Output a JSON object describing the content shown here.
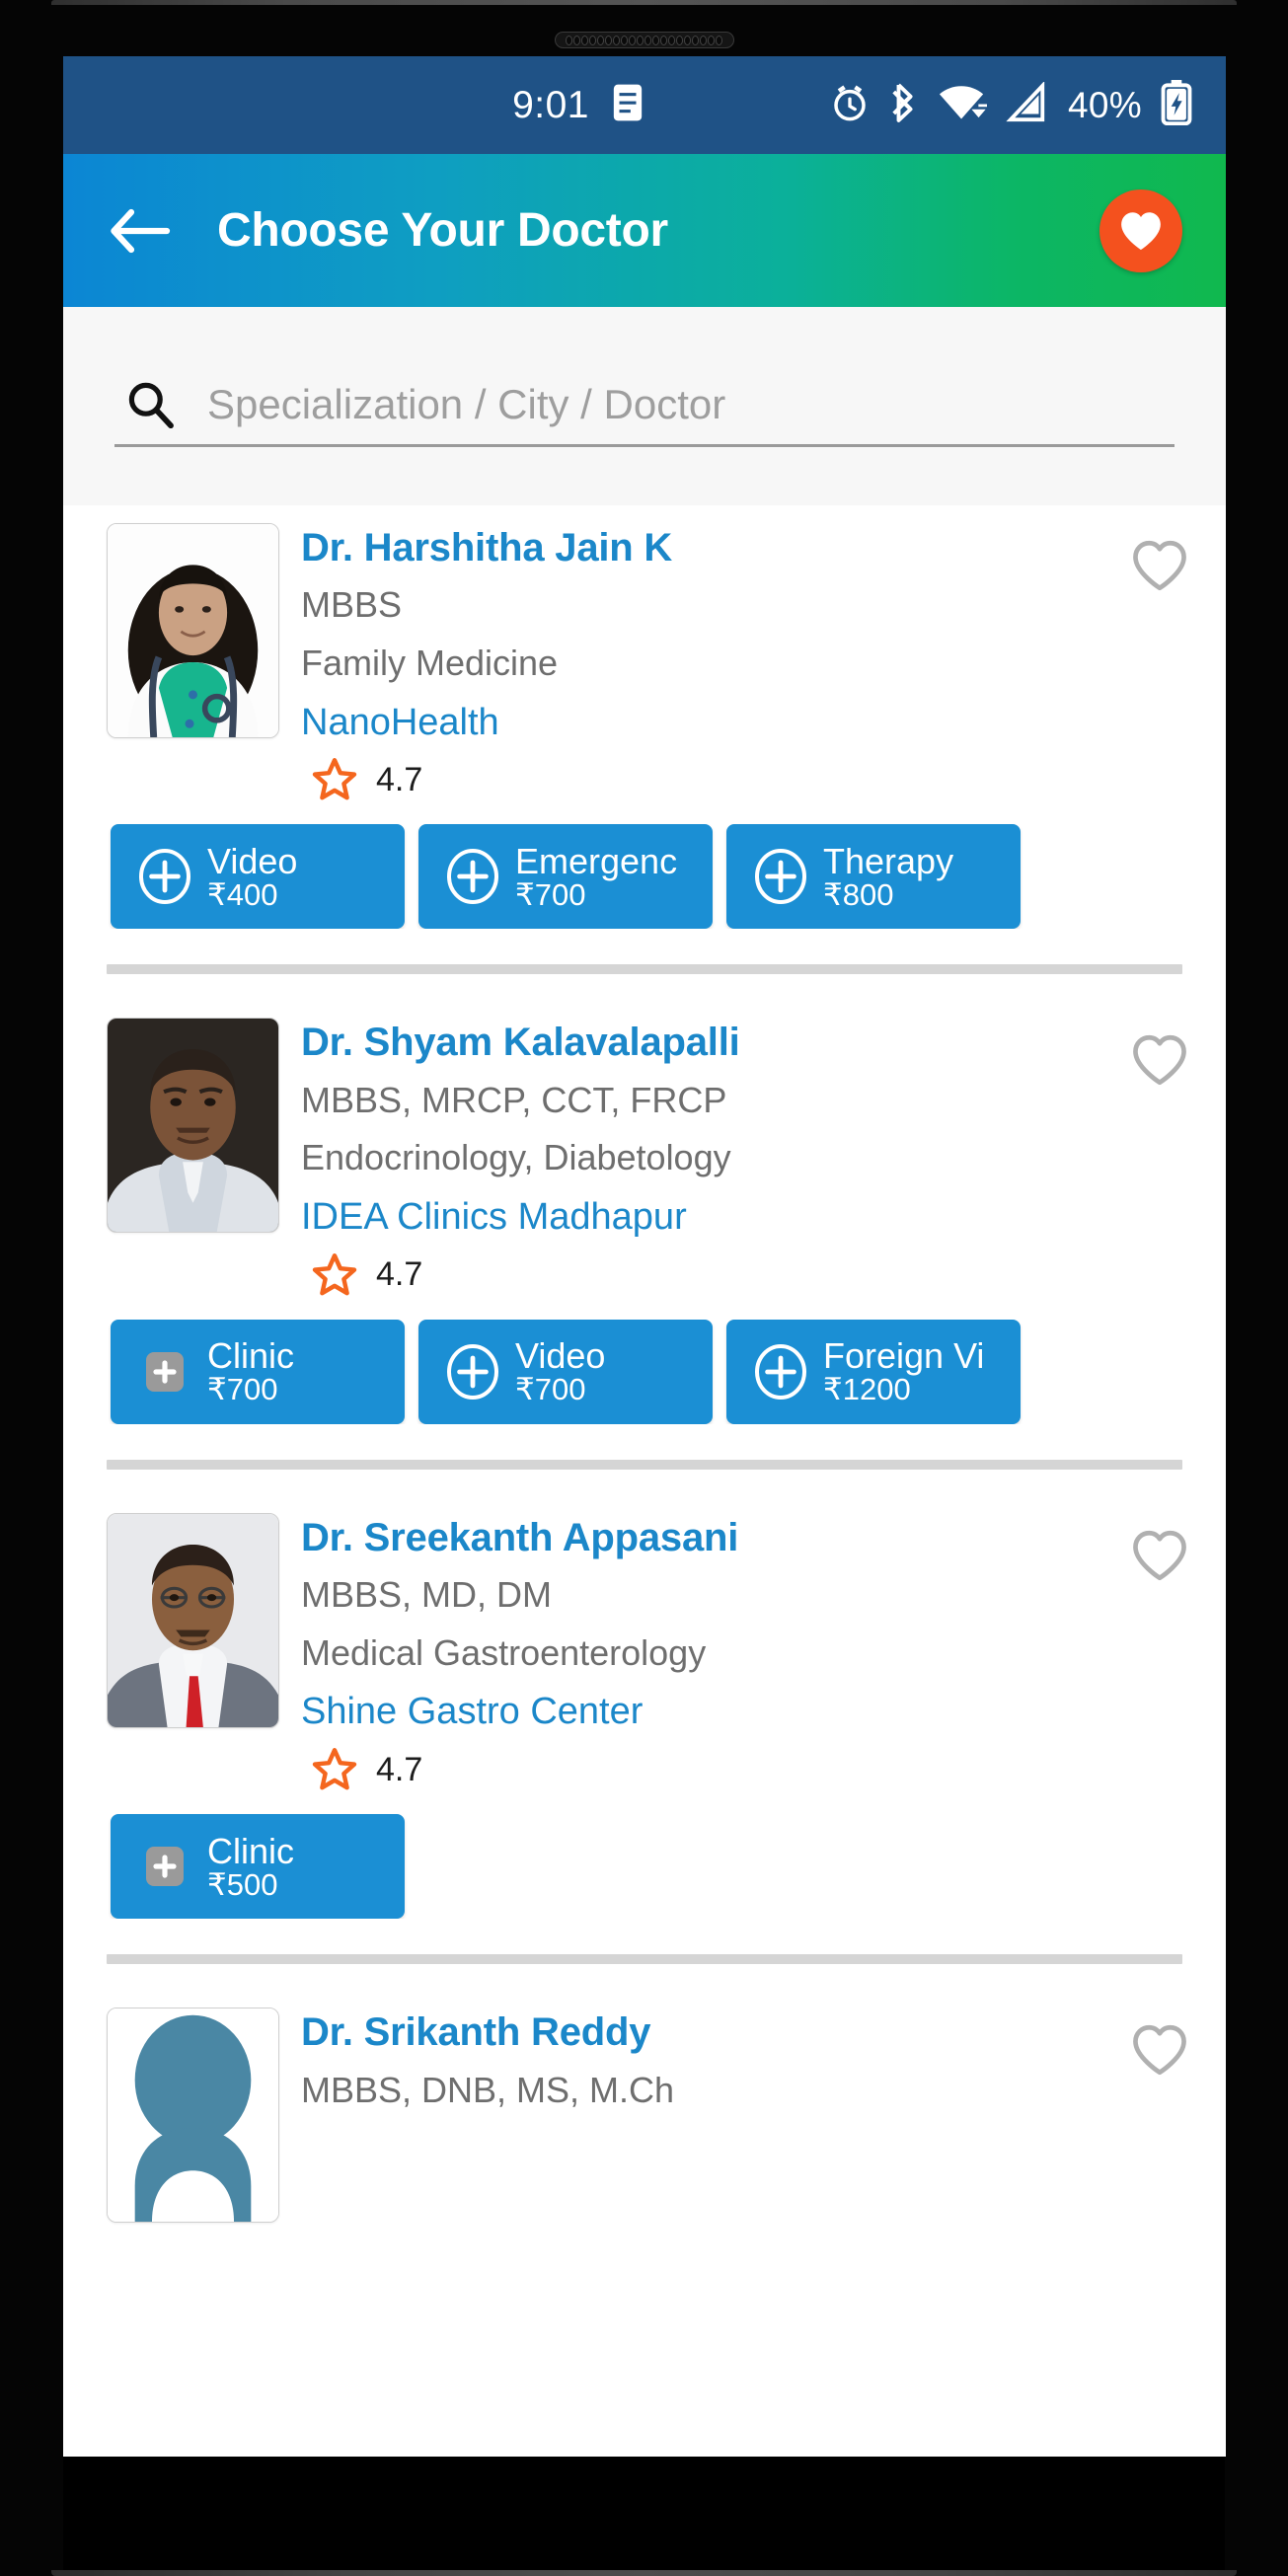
{
  "status_bar": {
    "time": "9:01",
    "battery_percent": "40%",
    "background_color": "#1f5286",
    "icons": [
      "notes-icon",
      "alarm-icon",
      "bluetooth-icon",
      "wifi-icon",
      "cellular-signal-icon",
      "battery-charging-icon"
    ]
  },
  "header": {
    "title": "Choose Your Doctor",
    "back_icon": "arrow-left-icon",
    "favorites_icon": "heart-filled-icon",
    "favorites_button_color": "#f4511e",
    "gradient_from": "#0c86d4",
    "gradient_to": "#10b84e"
  },
  "search": {
    "placeholder": "Specialization / City / Doctor",
    "value": "",
    "icon": "search-icon"
  },
  "accent_colors": {
    "link_blue": "#1b87c9",
    "button_blue": "#1b8fd4",
    "star_orange": "#f4661e",
    "heart_outline": "#b0b0b0"
  },
  "doctors": [
    {
      "name": "Dr. Harshitha Jain K",
      "degrees": "MBBS",
      "specialization": "Family Medicine",
      "hospital": "NanoHealth",
      "rating": "4.7",
      "avatar": "doctor-photo-female",
      "favorite": false,
      "actions": [
        {
          "label": "Video",
          "price": "₹400",
          "icon_style": "circle"
        },
        {
          "label": "Emergenc",
          "price": "₹700",
          "icon_style": "circle"
        },
        {
          "label": "Therapy",
          "price": "₹800",
          "icon_style": "circle"
        }
      ]
    },
    {
      "name": "Dr. Shyam Kalavalapalli",
      "degrees": "MBBS, MRCP, CCT, FRCP",
      "specialization": "Endocrinology, Diabetology",
      "hospital": "IDEA Clinics Madhapur",
      "rating": "4.7",
      "avatar": "doctor-photo-male-1",
      "favorite": false,
      "actions": [
        {
          "label": "Clinic",
          "price": "₹700",
          "icon_style": "square-gray"
        },
        {
          "label": "Video",
          "price": "₹700",
          "icon_style": "circle"
        },
        {
          "label": "Foreign Vi",
          "price": "₹1200",
          "icon_style": "circle"
        }
      ]
    },
    {
      "name": "Dr. Sreekanth Appasani",
      "degrees": "MBBS, MD, DM",
      "specialization": "Medical Gastroenterology",
      "hospital": "Shine Gastro Center",
      "rating": "4.7",
      "avatar": "doctor-photo-male-2",
      "favorite": false,
      "actions": [
        {
          "label": "Clinic",
          "price": "₹500",
          "icon_style": "square-gray"
        }
      ]
    },
    {
      "name": "Dr. Srikanth Reddy",
      "degrees": "MBBS, DNB, MS, M.Ch",
      "specialization": "",
      "hospital": "",
      "rating": "",
      "avatar": "avatar-placeholder",
      "favorite": false,
      "actions": []
    }
  ]
}
